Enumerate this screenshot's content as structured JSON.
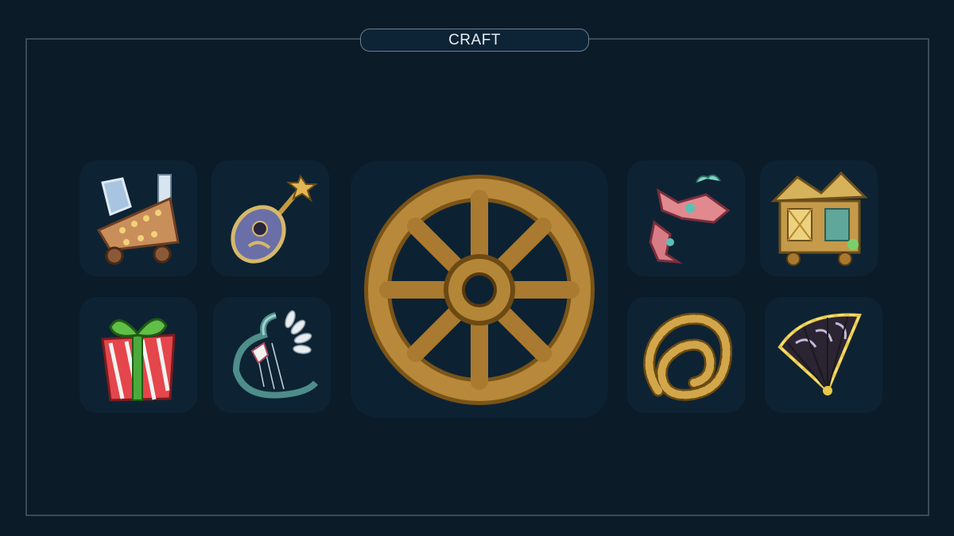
{
  "panel": {
    "title": "CRAFT"
  },
  "items": [
    {
      "icon": "wagon-icon"
    },
    {
      "icon": "lute-icon"
    },
    {
      "icon": "wheel-icon"
    },
    {
      "icon": "crown-ornament-icon"
    },
    {
      "icon": "lantern-house-icon"
    },
    {
      "icon": "gift-box-icon"
    },
    {
      "icon": "harp-icon"
    },
    {
      "icon": "rope-coil-icon"
    },
    {
      "icon": "folding-fan-icon"
    }
  ],
  "colors": {
    "background": "#0b1b28",
    "slot": "#0d2334",
    "frame_border": "#3d4a55",
    "pill_border": "#6b7f92"
  }
}
